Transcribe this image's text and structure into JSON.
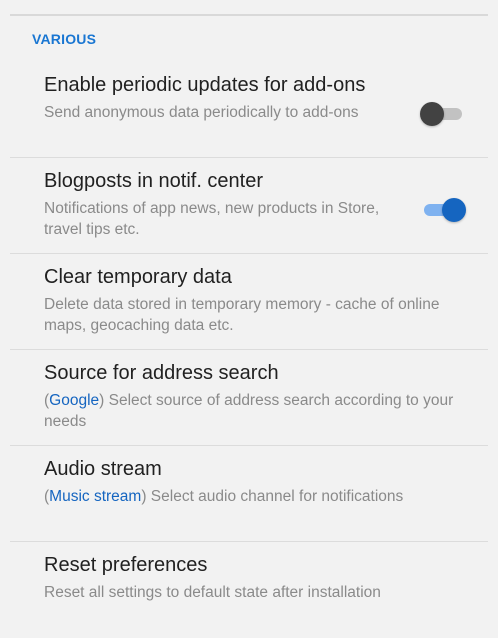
{
  "section": {
    "title": "VARIOUS"
  },
  "settings": [
    {
      "title": "Enable periodic updates for add-ons",
      "description": "Send anonymous data periodically to add-ons",
      "toggle": "off"
    },
    {
      "title": "Blogposts in notif. center",
      "description": "Notifications of app news, new products in Store, travel tips etc.",
      "toggle": "on"
    },
    {
      "title": "Clear temporary data",
      "description": "Delete data stored in temporary memory - cache of online maps, geocaching data etc."
    },
    {
      "title": "Source for address search",
      "value": "Google",
      "description": "Select source of address search according to your needs"
    },
    {
      "title": "Audio stream",
      "value": "Music stream",
      "description": "Select audio channel for notifications"
    },
    {
      "title": "Reset preferences",
      "description": "Reset all settings to default state after installation"
    }
  ],
  "colors": {
    "accent": "#1565c0",
    "section_header": "#1976d2",
    "toggle_off": "#424242",
    "background": "#f2f2f2"
  }
}
